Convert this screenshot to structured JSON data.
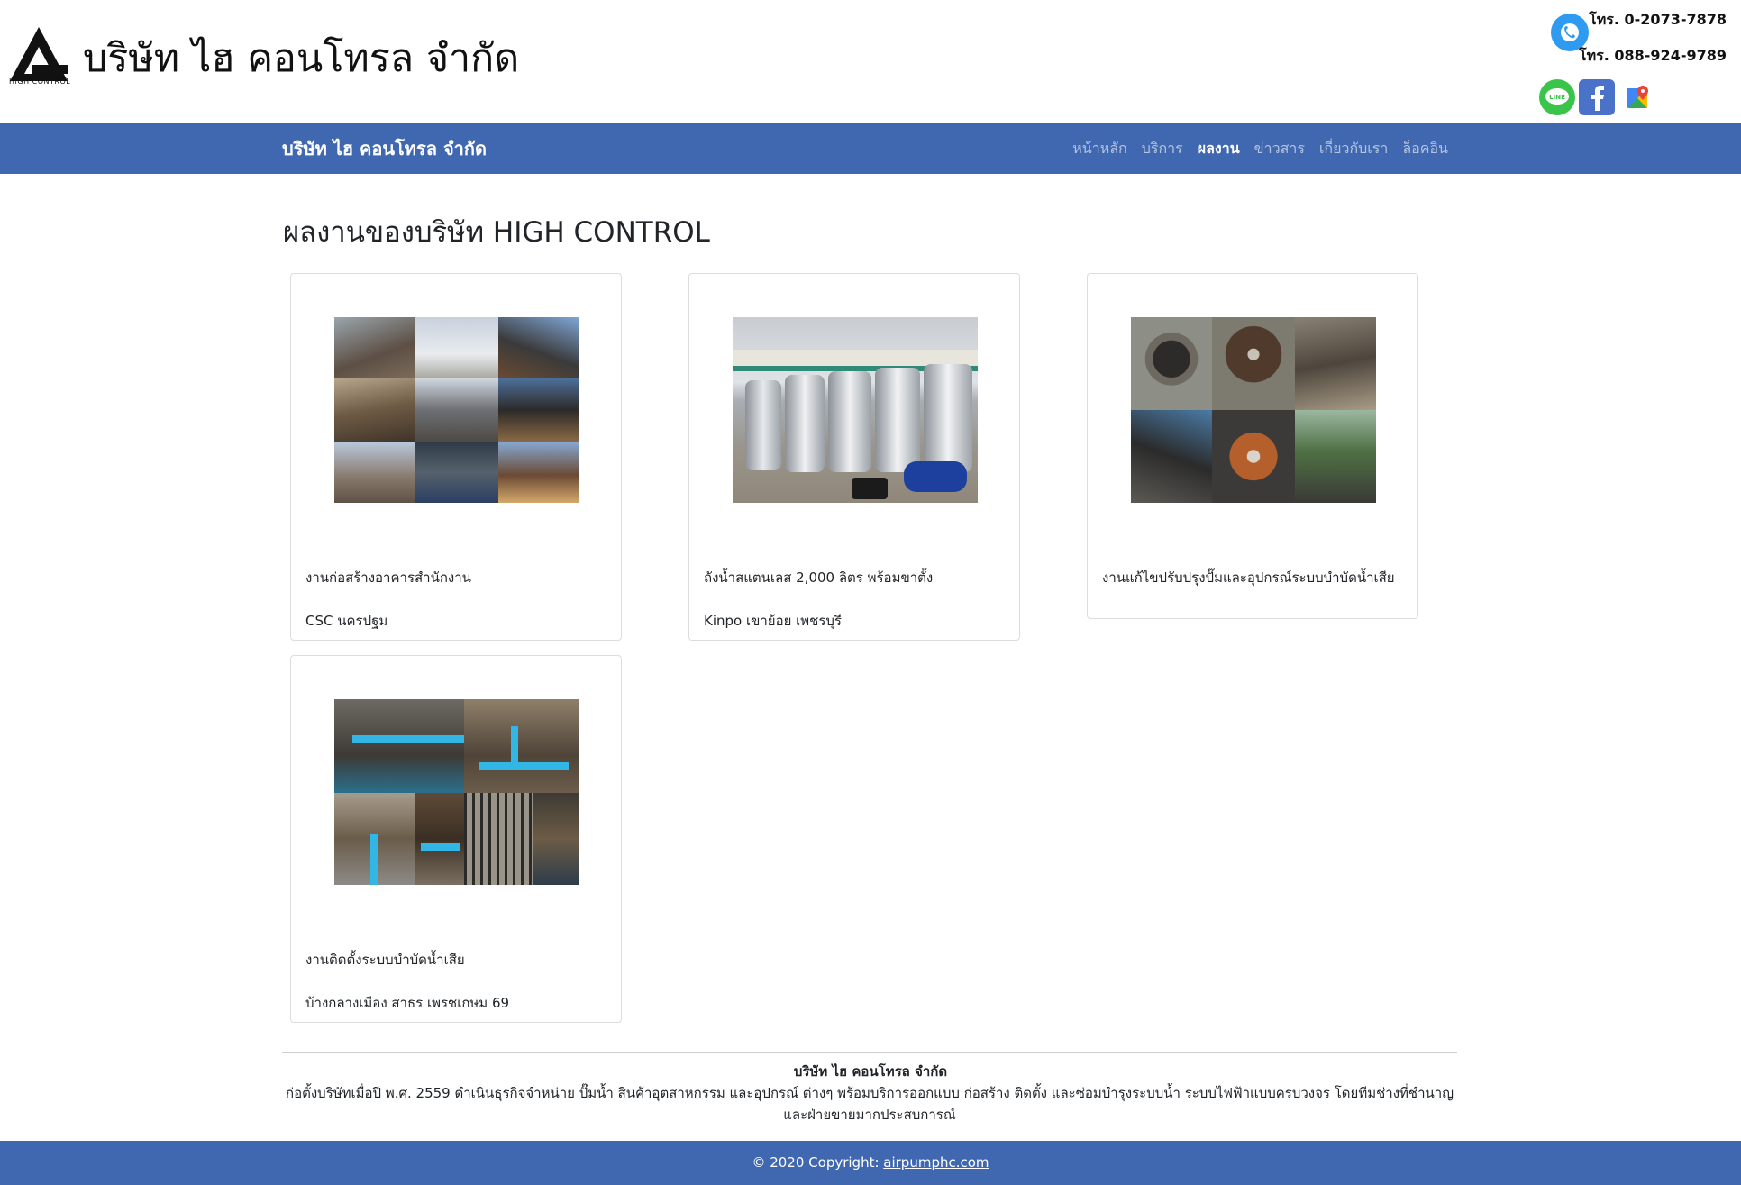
{
  "header": {
    "logo_text": "HIGH CONTROL",
    "company_name": "บริษัท ไฮ  คอนโทรล จำกัด",
    "phone_1": "โทร. 0-2073-7878",
    "phone_2": "โทร. 088-924-9789",
    "social_icons": [
      "line-icon",
      "facebook-icon",
      "google-maps-icon"
    ]
  },
  "navbar": {
    "brand": "บริษัท ไฮ  คอนโทรล จำกัด",
    "links": [
      {
        "label": "หน้าหลัก",
        "active": false
      },
      {
        "label": "บริการ",
        "active": false
      },
      {
        "label": "ผลงาน",
        "active": true
      },
      {
        "label": "ข่าวสาร",
        "active": false
      },
      {
        "label": "เกี่ยวกับเรา",
        "active": false
      },
      {
        "label": "ล็อคอิน",
        "active": false
      }
    ],
    "bg_color": "#4068b0"
  },
  "main": {
    "page_title": "ผลงานของบริษัท HIGH CONTROL",
    "cards": [
      {
        "title": "งานก่อสร้างอาคารสำนักงาน",
        "subtitle": "CSC นครปฐม"
      },
      {
        "title": "ถังน้ำสแตนเลส 2,000 ลิตร พร้อมขาตั้ง",
        "subtitle": "Kinpo เขาย้อย เพชรบุรี"
      },
      {
        "title": "งานแก้ไขปรับปรุงปั๊มและอุปกรณ์ระบบบำบัดน้ำเสีย",
        "subtitle": ""
      },
      {
        "title": "งานติดตั้งระบบบำบัดน้ำเสีย",
        "subtitle": "บ้างกลางเมือง สาธร เพรชเกษม 69"
      }
    ]
  },
  "footer": {
    "company": "บริษัท ไฮ  คอนโทรล จำกัด",
    "description": "ก่อตั้งบริษัทเมื่อปี พ.ศ. 2559 ดำเนินธุรกิจจำหน่าย ปั๊มน้ำ สินค้าอุตสาหกรรม และอุปกรณ์ ต่างๆ พร้อมบริการออกแบบ ก่อสร้าง ติดตั้ง และซ่อมบำรุงระบบน้ำ ระบบไฟฟ้าแบบครบวงจร โดยทีมช่างที่ชำนาญและฝ่ายขายมากประสบการณ์",
    "copyright_prefix": "© 2020 Copyright: ",
    "copyright_link": "airpumphc.com"
  }
}
